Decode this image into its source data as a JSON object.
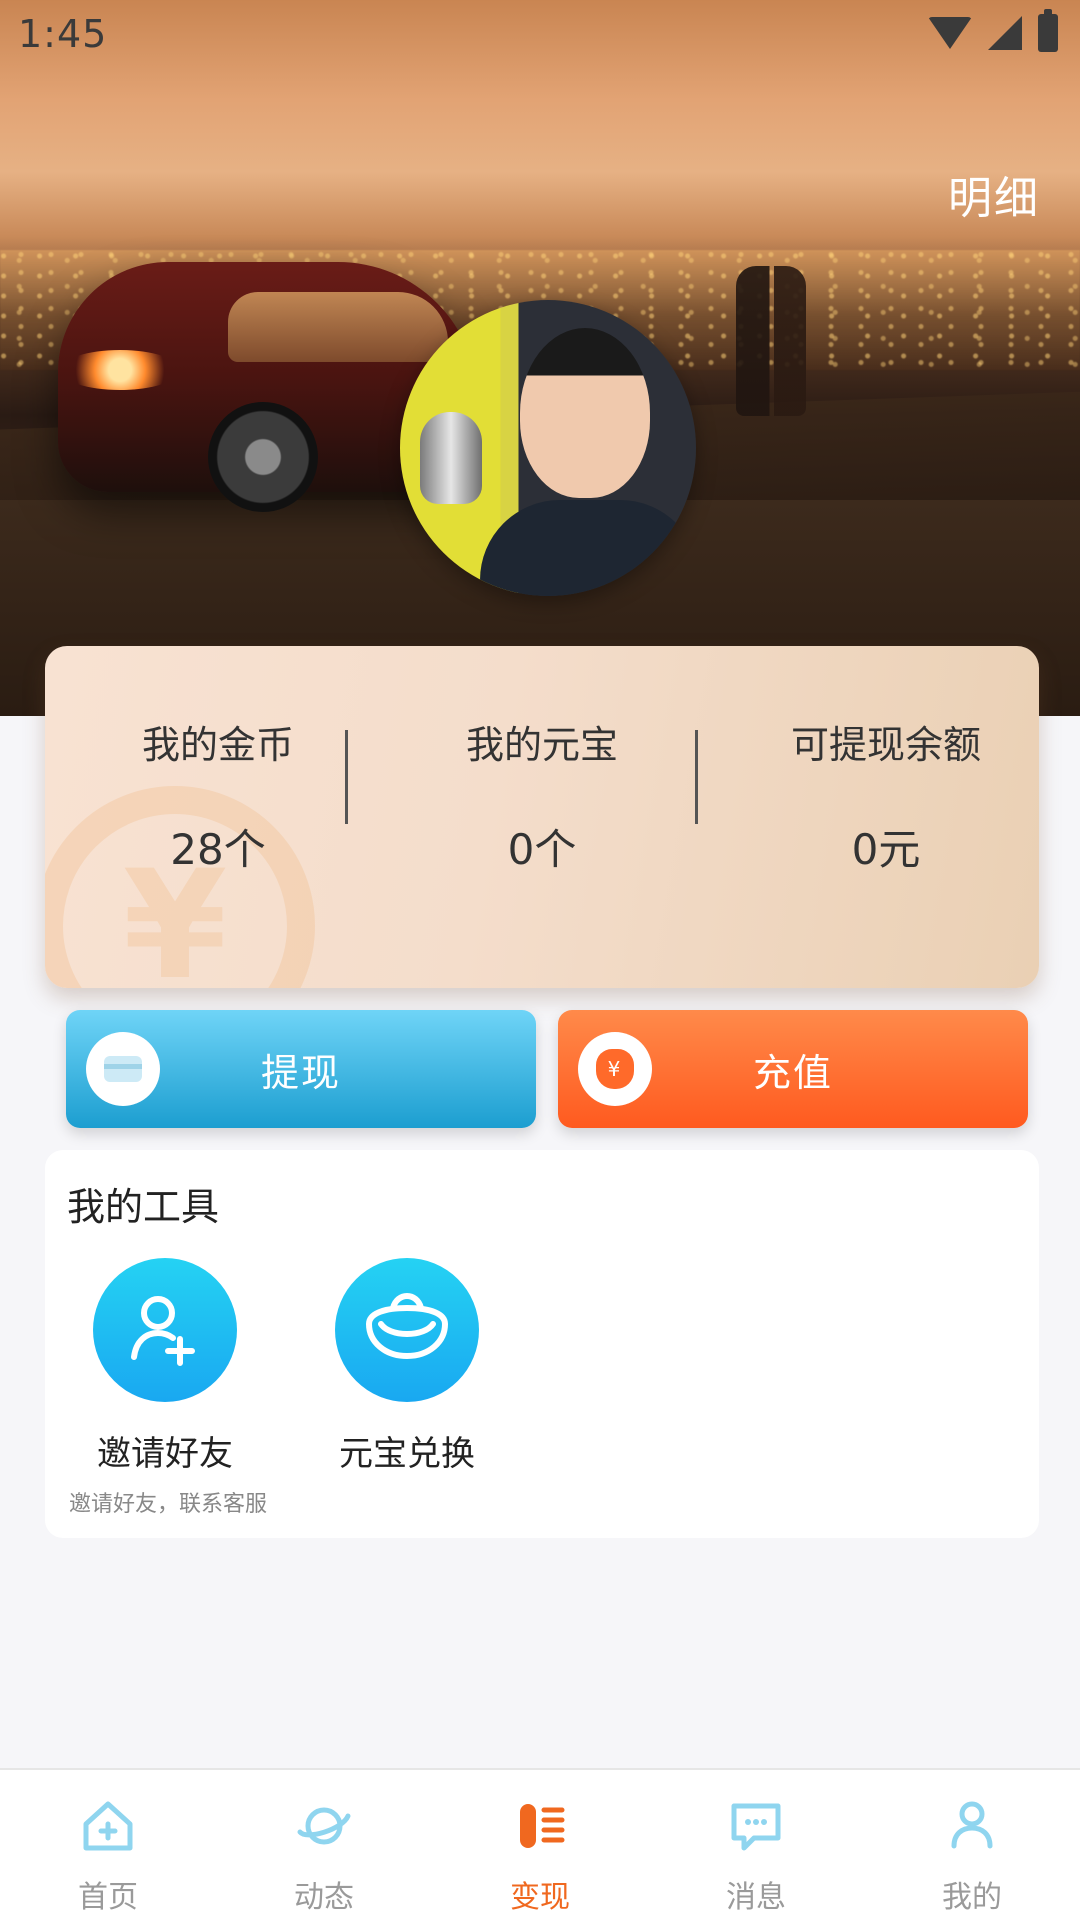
{
  "status_bar": {
    "time": "1:45"
  },
  "header": {
    "detail_link": "明细"
  },
  "balance": {
    "coins_label": "我的金币",
    "coins_value": "28个",
    "yuanbao_label": "我的元宝",
    "yuanbao_value": "0个",
    "withdrawable_label": "可提现余额",
    "withdrawable_value": "0元",
    "watermark_symbol": "¥"
  },
  "actions": {
    "withdraw_label": "提现",
    "recharge_label": "充值",
    "recharge_icon_glyph": "¥"
  },
  "tools": {
    "title": "我的工具",
    "items": [
      {
        "label": "邀请好友",
        "icon": "add-user-icon"
      },
      {
        "label": "元宝兑换",
        "icon": "gold-ingot-icon"
      }
    ],
    "invite_subtext": "邀请好友，联系客服"
  },
  "bottom_nav": {
    "items": [
      {
        "label": "首页",
        "icon": "home-icon"
      },
      {
        "label": "动态",
        "icon": "planet-icon"
      },
      {
        "label": "变现",
        "icon": "monetize-icon"
      },
      {
        "label": "消息",
        "icon": "message-icon"
      },
      {
        "label": "我的",
        "icon": "profile-icon"
      }
    ],
    "active_index": 2
  },
  "colors": {
    "accent_active": "#f0681f",
    "withdraw_button": "#1c9ed0",
    "recharge_button": "#ff5a1f",
    "tool_icon_bg": "#19a8f1",
    "nav_inactive": "#9a9a9a",
    "nav_icon_blue": "#8fd5ef"
  }
}
